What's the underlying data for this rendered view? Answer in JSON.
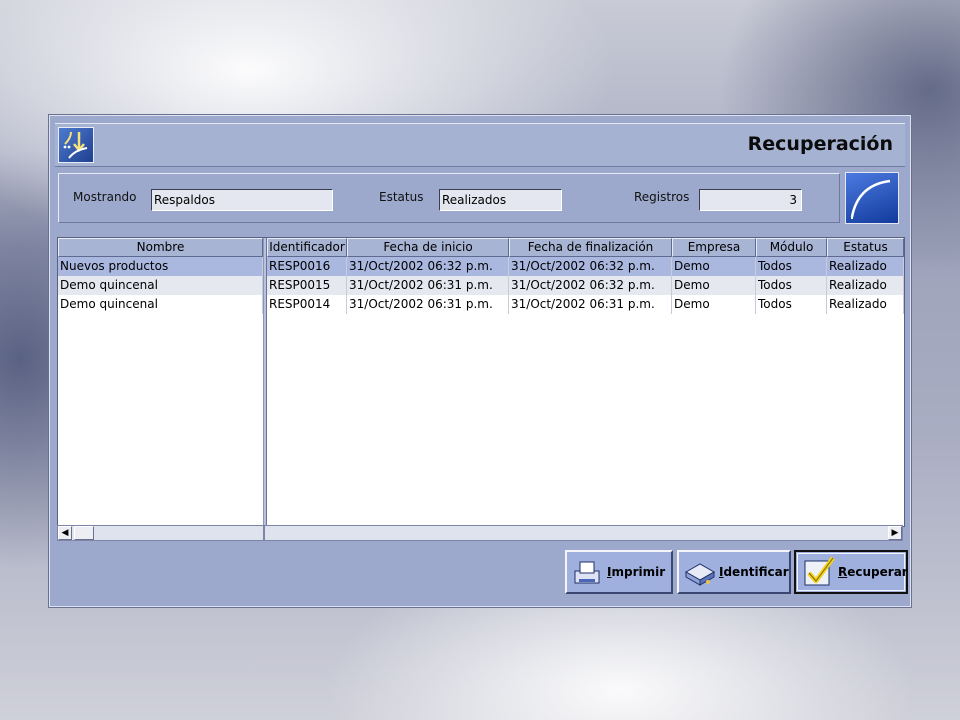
{
  "window": {
    "title": "Recuperación"
  },
  "filters": {
    "showing_label": "Mostrando",
    "showing_value": "Respaldos",
    "status_label": "Estatus",
    "status_value": "Realizados",
    "records_label": "Registros",
    "records_value": "3"
  },
  "table": {
    "columns": [
      "Nombre",
      "Identificador",
      "Fecha de inicio",
      "Fecha de finalización",
      "Empresa",
      "Módulo",
      "Estatus"
    ],
    "rows": [
      {
        "nombre": "Nuevos productos",
        "id": "RESP0016",
        "inicio": "31/Oct/2002 06:32 p.m.",
        "fin": "31/Oct/2002 06:32 p.m.",
        "empresa": "Demo",
        "modulo": "Todos",
        "estatus": "Realizado",
        "selected": true
      },
      {
        "nombre": "Demo quincenal",
        "id": "RESP0015",
        "inicio": "31/Oct/2002 06:31 p.m.",
        "fin": "31/Oct/2002 06:32 p.m.",
        "empresa": "Demo",
        "modulo": "Todos",
        "estatus": "Realizado",
        "selected": false
      },
      {
        "nombre": "Demo quincenal",
        "id": "RESP0014",
        "inicio": "31/Oct/2002 06:31 p.m.",
        "fin": "31/Oct/2002 06:31 p.m.",
        "empresa": "Demo",
        "modulo": "Todos",
        "estatus": "Realizado",
        "selected": false
      }
    ]
  },
  "actions": {
    "print": {
      "label_pre": "",
      "label_u": "I",
      "label_post": "mprimir"
    },
    "identify": {
      "label_pre": "",
      "label_u": "I",
      "label_post": "dentificar"
    },
    "recover": {
      "label_pre": "",
      "label_u": "R",
      "label_post": "ecuperar"
    }
  },
  "colors": {
    "window_bg": "#9ca9cd",
    "header_bg": "#a8b4d4",
    "selected_row": "#aab8e0",
    "alt_row": "#e6e8f0"
  },
  "icons": {
    "app": "recovery-arrows-icon",
    "curve": "curve-icon",
    "print": "printer-icon",
    "identify": "tape-drive-icon",
    "recover": "checkmark-icon"
  }
}
